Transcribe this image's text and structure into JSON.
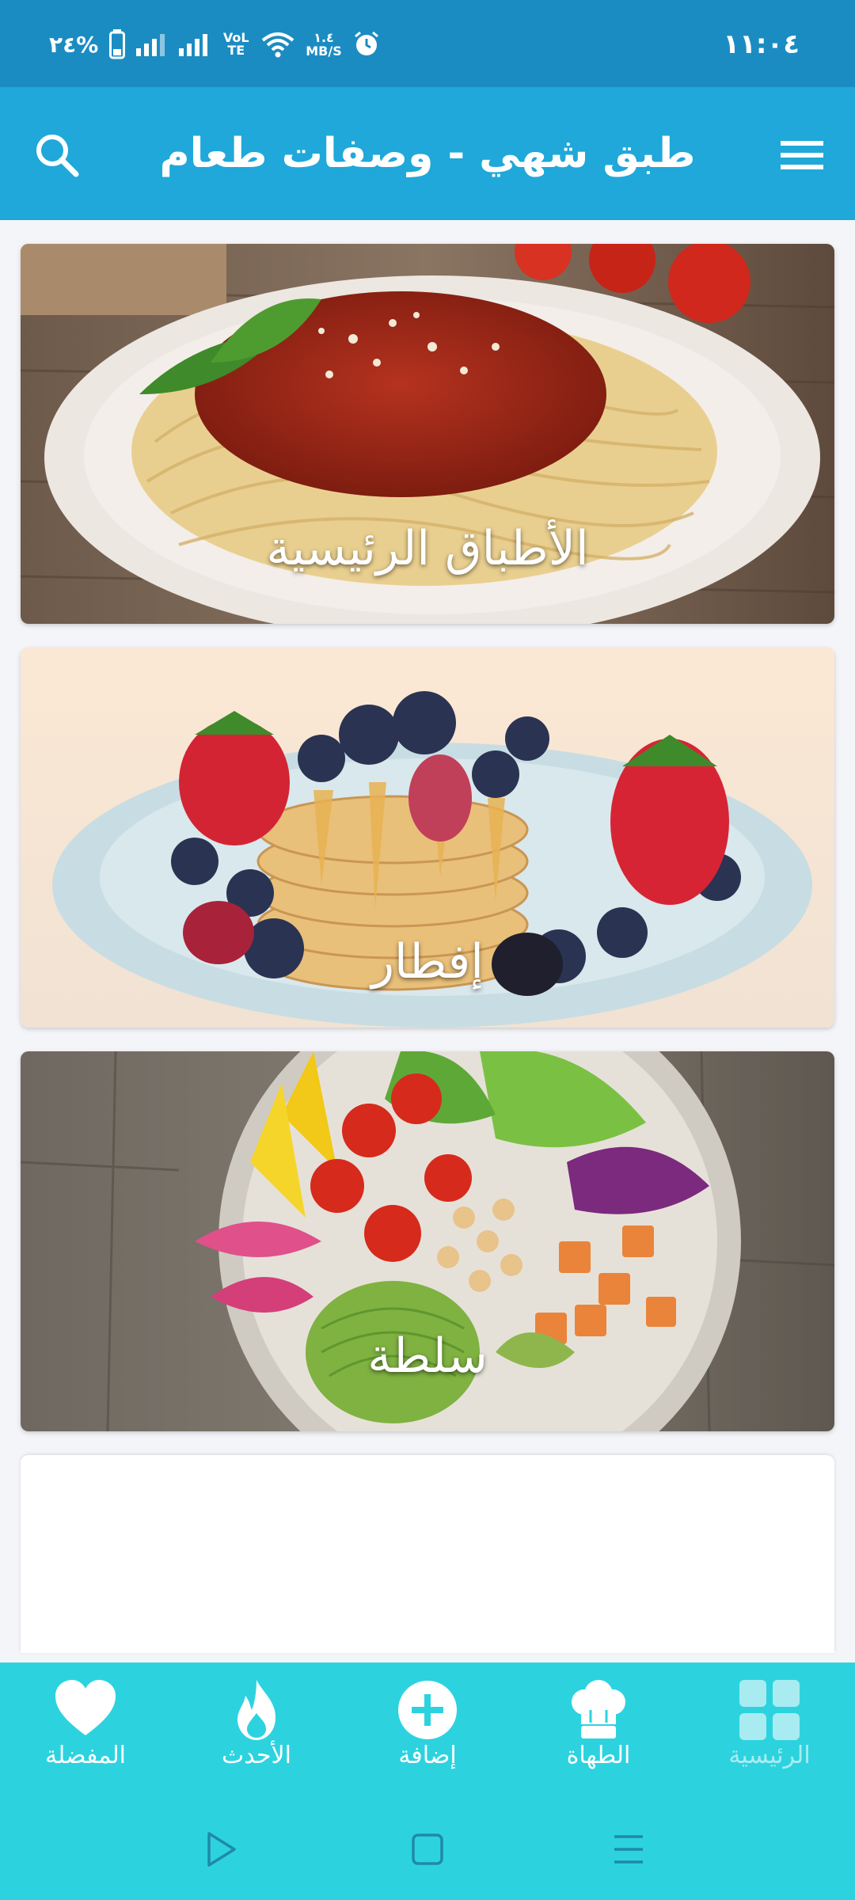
{
  "status_bar": {
    "time": "١١:٠٤",
    "battery": "%٢٤",
    "network": "VoLTE",
    "speed_value": "١.٤",
    "speed_unit": "MB/S"
  },
  "app_bar": {
    "title": "طبق شهي - وصفات طعام",
    "search_icon": "search-icon",
    "menu_icon": "menu-icon"
  },
  "categories": [
    {
      "label": "الأطباق الرئيسية",
      "image": "spaghetti-bolognese"
    },
    {
      "label": "إفطار",
      "image": "pancakes-with-berries"
    },
    {
      "label": "سلطة",
      "image": "salad-bowl"
    }
  ],
  "bottom_nav": {
    "items": [
      {
        "label": "المفضلة",
        "icon": "heart-icon"
      },
      {
        "label": "الأحدث",
        "icon": "flame-icon"
      },
      {
        "label": "إضافة",
        "icon": "plus-circle-icon"
      },
      {
        "label": "الطهاة",
        "icon": "chef-hat-icon"
      },
      {
        "label": "الرئيسية",
        "icon": "grid-icon",
        "active": true
      }
    ]
  },
  "system_nav": {
    "back_icon": "back-triangle-icon",
    "home_icon": "home-square-icon",
    "recents_icon": "recents-lines-icon"
  },
  "colors": {
    "status_bar": "#1b8cc2",
    "app_bar": "#1fa8d9",
    "bottom_nav": "#2cd3df",
    "background": "#f4f5f8"
  }
}
